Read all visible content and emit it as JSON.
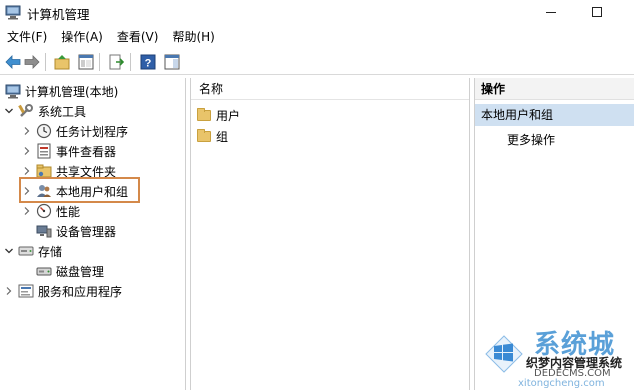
{
  "window": {
    "title": "计算机管理",
    "controls": {
      "minimize_icon": "minimize-icon",
      "maximize_icon": "maximize-icon"
    }
  },
  "menu": {
    "items": [
      {
        "label": "文件(F)"
      },
      {
        "label": "操作(A)"
      },
      {
        "label": "查看(V)"
      },
      {
        "label": "帮助(H)"
      }
    ]
  },
  "toolbar": {
    "icons": [
      "back-arrow-icon",
      "forward-arrow-icon",
      "up-folder-icon",
      "show-hide-tree-icon",
      "export-list-icon",
      "help-icon",
      "action-pane-icon"
    ]
  },
  "tree": {
    "root": "计算机管理(本地)",
    "system_tools": "系统工具",
    "task_scheduler": "任务计划程序",
    "event_viewer": "事件查看器",
    "shared_folders": "共享文件夹",
    "local_users_groups": "本地用户和组",
    "performance": "性能",
    "device_manager": "设备管理器",
    "storage": "存储",
    "disk_management": "磁盘管理",
    "services_apps": "服务和应用程序"
  },
  "middle": {
    "column_name": "名称",
    "items": [
      {
        "label": "用户"
      },
      {
        "label": "组"
      }
    ]
  },
  "actions": {
    "header": "操作",
    "section": "本地用户和组",
    "more": "更多操作"
  },
  "watermark": {
    "brand": "系统城",
    "line1": "织梦内容管理系统",
    "line2": "DEDECMS.COM",
    "line3": "xitongcheng.com"
  },
  "colors": {
    "highlight_border": "#d4894a",
    "action_section_bg": "#cfe0f1",
    "folder": "#e9c46a"
  }
}
